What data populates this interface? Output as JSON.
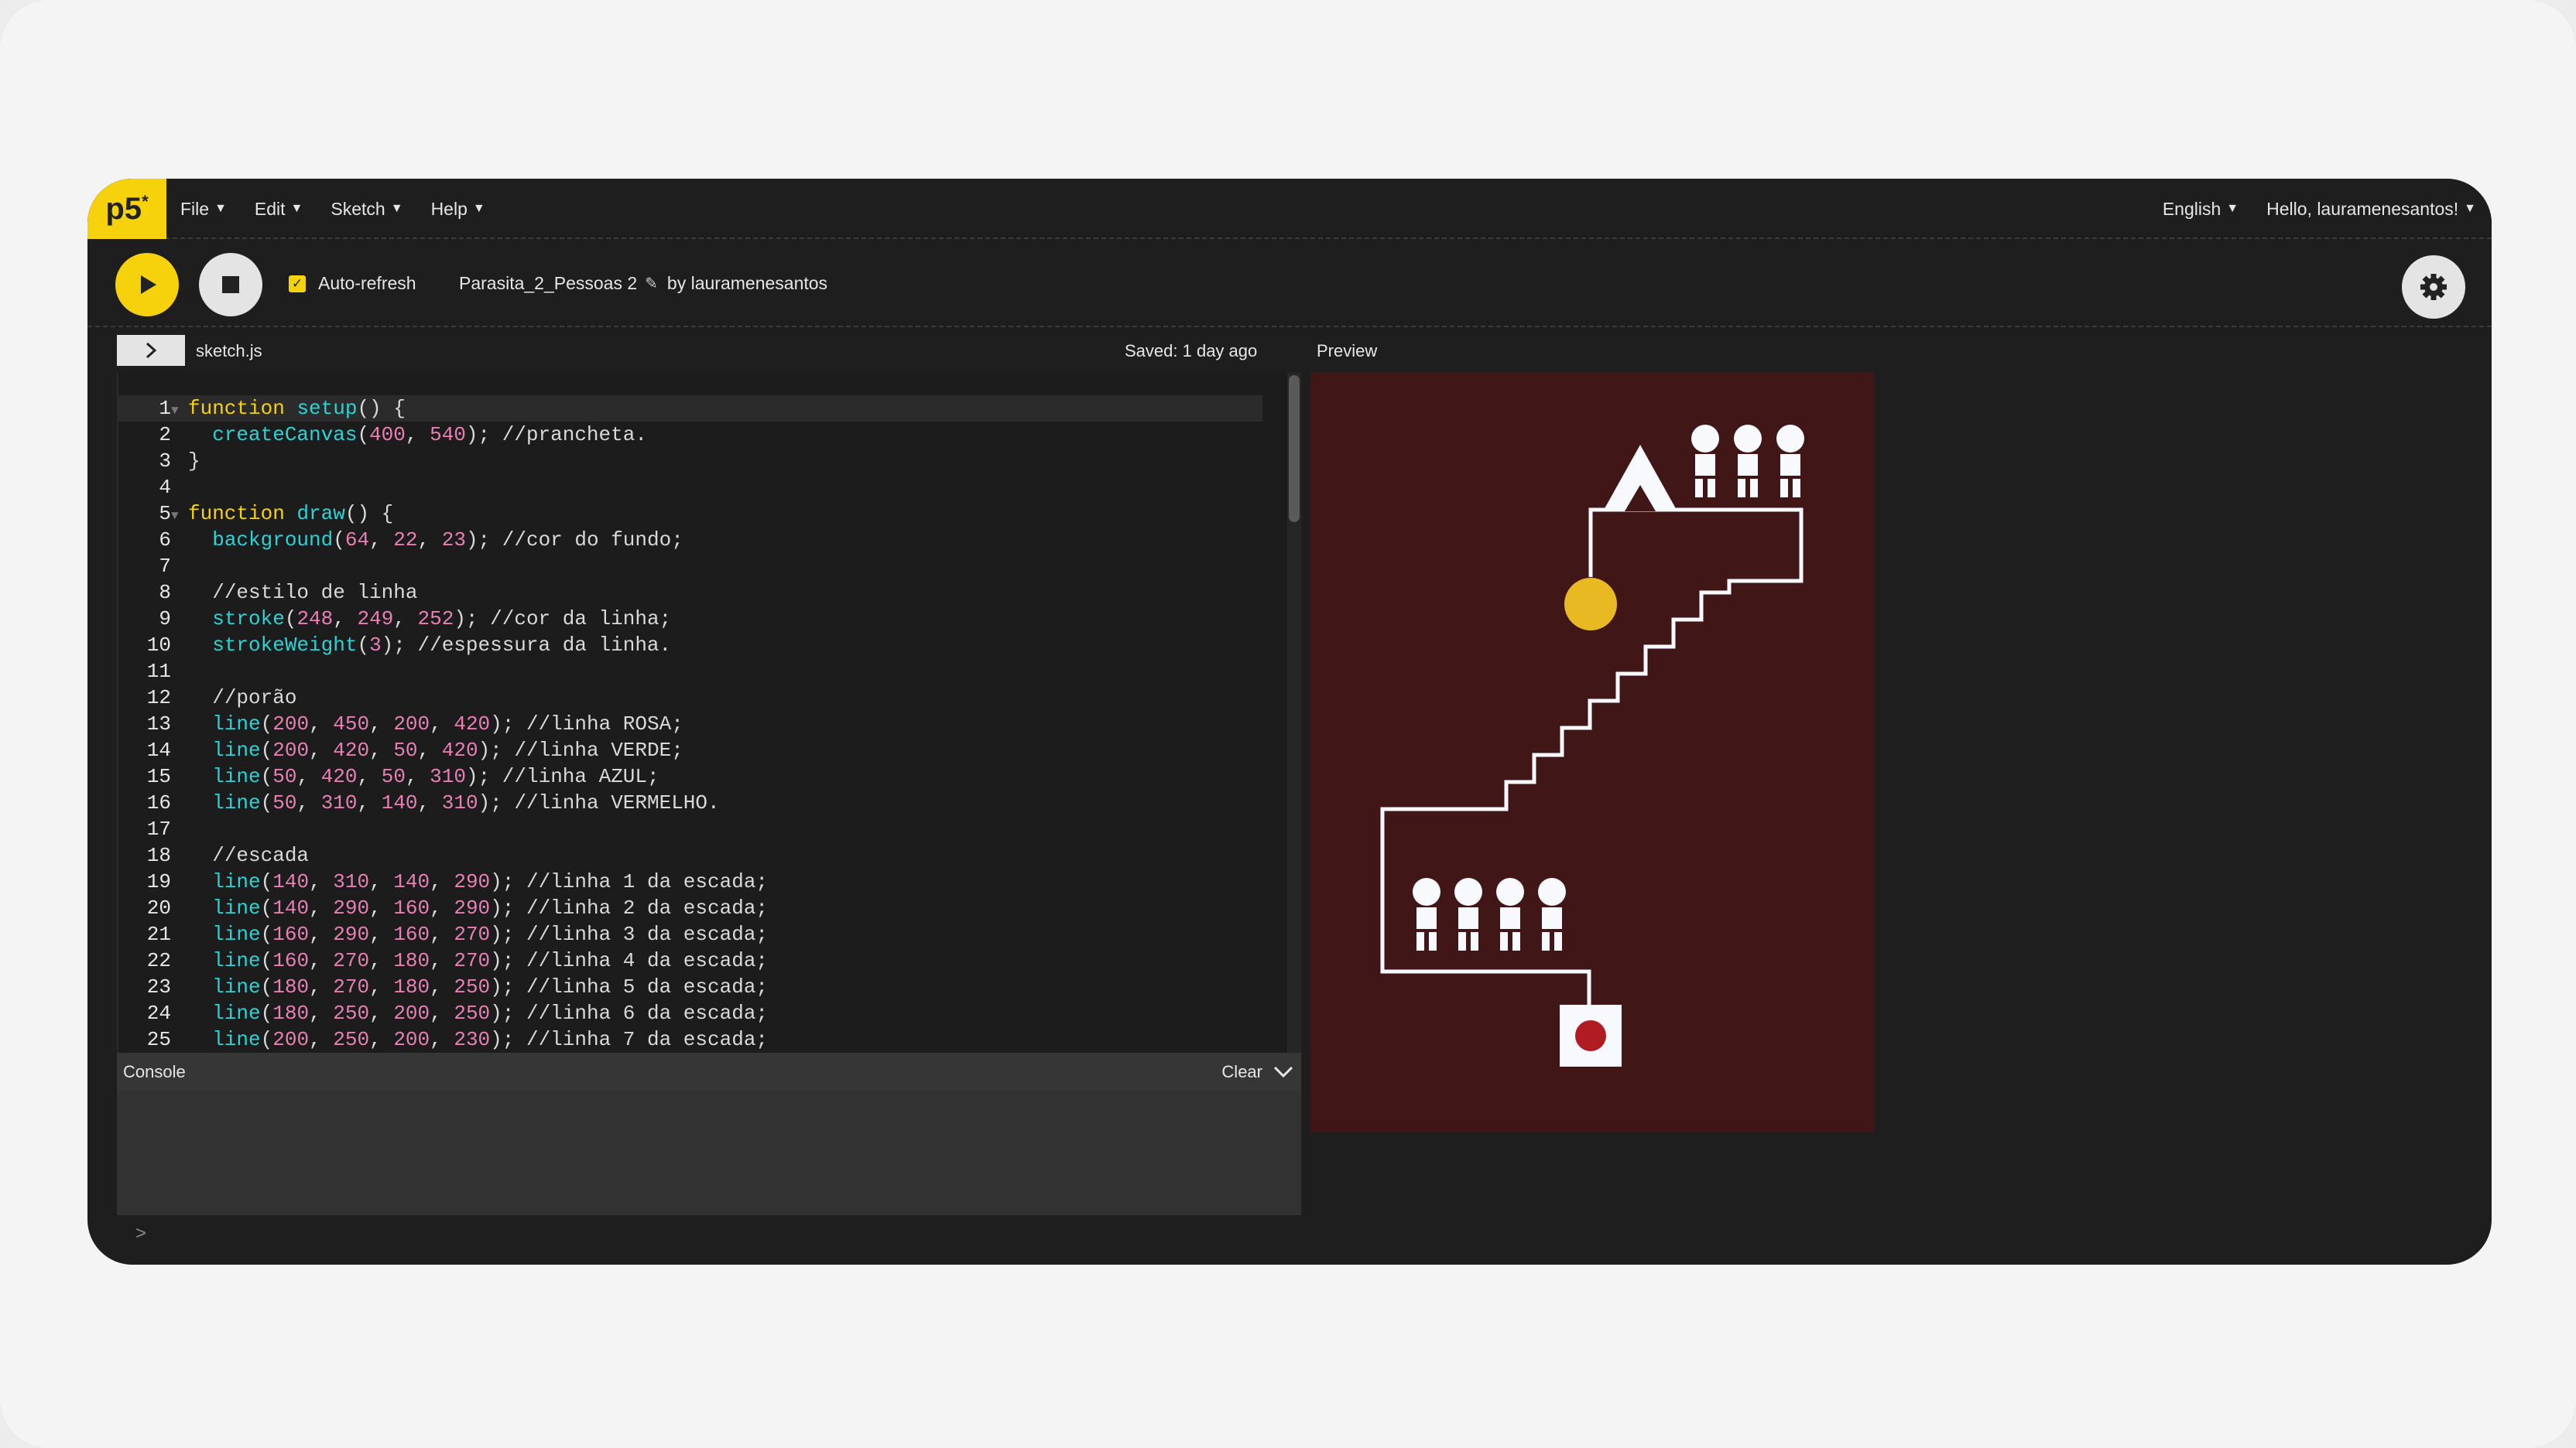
{
  "nav": {
    "logo": "p5",
    "logo_sup": "*",
    "menus": [
      "File",
      "Edit",
      "Sketch",
      "Help"
    ],
    "language": "English",
    "user": "Hello, lauramenesantos!"
  },
  "toolbar": {
    "auto_refresh_label": "Auto-refresh",
    "auto_refresh_checked": true,
    "sketch_name": "Parasita_2_Pessoas 2",
    "by_author": "by lauramenesantos"
  },
  "editor": {
    "filename": "sketch.js",
    "saved_status": "Saved: 1 day ago",
    "lines": [
      {
        "n": "1",
        "text": "function setup() {",
        "fold": true
      },
      {
        "n": "2",
        "text": "  createCanvas(400, 540); //prancheta."
      },
      {
        "n": "3",
        "text": "}"
      },
      {
        "n": "4",
        "text": ""
      },
      {
        "n": "5",
        "text": "function draw() {",
        "fold": true
      },
      {
        "n": "6",
        "text": "  background(64, 22, 23); //cor do fundo;"
      },
      {
        "n": "7",
        "text": ""
      },
      {
        "n": "8",
        "text": "  //estilo de linha"
      },
      {
        "n": "9",
        "text": "  stroke(248, 249, 252); //cor da linha;"
      },
      {
        "n": "10",
        "text": "  strokeWeight(3); //espessura da linha."
      },
      {
        "n": "11",
        "text": ""
      },
      {
        "n": "12",
        "text": "  //porão"
      },
      {
        "n": "13",
        "text": "  line(200, 450, 200, 420); //linha ROSA;"
      },
      {
        "n": "14",
        "text": "  line(200, 420, 50, 420); //linha VERDE;"
      },
      {
        "n": "15",
        "text": "  line(50, 420, 50, 310); //linha AZUL;"
      },
      {
        "n": "16",
        "text": "  line(50, 310, 140, 310); //linha VERMELHO."
      },
      {
        "n": "17",
        "text": ""
      },
      {
        "n": "18",
        "text": "  //escada"
      },
      {
        "n": "19",
        "text": "  line(140, 310, 140, 290); //linha 1 da escada;"
      },
      {
        "n": "20",
        "text": "  line(140, 290, 160, 290); //linha 2 da escada;"
      },
      {
        "n": "21",
        "text": "  line(160, 290, 160, 270); //linha 3 da escada;"
      },
      {
        "n": "22",
        "text": "  line(160, 270, 180, 270); //linha 4 da escada;"
      },
      {
        "n": "23",
        "text": "  line(180, 270, 180, 250); //linha 5 da escada;"
      },
      {
        "n": "24",
        "text": "  line(180, 250, 200, 250); //linha 6 da escada;"
      },
      {
        "n": "25",
        "text": "  line(200, 250, 200, 230); //linha 7 da escada;"
      }
    ]
  },
  "console": {
    "title": "Console",
    "clear_label": "Clear",
    "prompt": ">"
  },
  "preview": {
    "label": "Preview",
    "background_color": "#401617",
    "line_color": "#f8f9fc",
    "sun_color": "#e8b923",
    "dot_color": "#b01c22"
  },
  "colors": {
    "accent": "#f5d20b",
    "keyword": "#f5d20b",
    "function": "#2ad3d6",
    "number": "#e97fb5"
  }
}
